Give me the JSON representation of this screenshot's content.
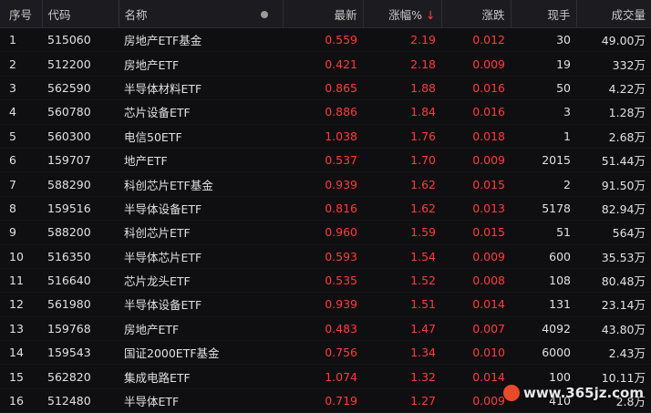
{
  "header": {
    "seq": "序号",
    "code": "代码",
    "name": "名称",
    "latest": "最新",
    "pct": "涨幅%",
    "change": "涨跌",
    "volume": "现手",
    "amount": "成交量"
  },
  "rows": [
    {
      "seq": "1",
      "code": "515060",
      "name": "房地产ETF基金",
      "latest": "0.559",
      "pct": "2.19",
      "change": "0.012",
      "volume": "30",
      "amount": "49.00万"
    },
    {
      "seq": "2",
      "code": "512200",
      "name": "房地产ETF",
      "latest": "0.421",
      "pct": "2.18",
      "change": "0.009",
      "volume": "19",
      "amount": "332万"
    },
    {
      "seq": "3",
      "code": "562590",
      "name": "半导体材料ETF",
      "latest": "0.865",
      "pct": "1.88",
      "change": "0.016",
      "volume": "50",
      "amount": "4.22万"
    },
    {
      "seq": "4",
      "code": "560780",
      "name": "芯片设备ETF",
      "latest": "0.886",
      "pct": "1.84",
      "change": "0.016",
      "volume": "3",
      "amount": "1.28万"
    },
    {
      "seq": "5",
      "code": "560300",
      "name": "电信50ETF",
      "latest": "1.038",
      "pct": "1.76",
      "change": "0.018",
      "volume": "1",
      "amount": "2.68万"
    },
    {
      "seq": "6",
      "code": "159707",
      "name": "地产ETF",
      "latest": "0.537",
      "pct": "1.70",
      "change": "0.009",
      "volume": "2015",
      "amount": "51.44万"
    },
    {
      "seq": "7",
      "code": "588290",
      "name": "科创芯片ETF基金",
      "latest": "0.939",
      "pct": "1.62",
      "change": "0.015",
      "volume": "2",
      "amount": "91.50万"
    },
    {
      "seq": "8",
      "code": "159516",
      "name": "半导体设备ETF",
      "latest": "0.816",
      "pct": "1.62",
      "change": "0.013",
      "volume": "5178",
      "amount": "82.94万"
    },
    {
      "seq": "9",
      "code": "588200",
      "name": "科创芯片ETF",
      "latest": "0.960",
      "pct": "1.59",
      "change": "0.015",
      "volume": "51",
      "amount": "564万"
    },
    {
      "seq": "10",
      "code": "516350",
      "name": "半导体芯片ETF",
      "latest": "0.593",
      "pct": "1.54",
      "change": "0.009",
      "volume": "600",
      "amount": "35.53万"
    },
    {
      "seq": "11",
      "code": "516640",
      "name": "芯片龙头ETF",
      "latest": "0.535",
      "pct": "1.52",
      "change": "0.008",
      "volume": "108",
      "amount": "80.48万"
    },
    {
      "seq": "12",
      "code": "561980",
      "name": "半导体设备ETF",
      "latest": "0.939",
      "pct": "1.51",
      "change": "0.014",
      "volume": "131",
      "amount": "23.14万"
    },
    {
      "seq": "13",
      "code": "159768",
      "name": "房地产ETF",
      "latest": "0.483",
      "pct": "1.47",
      "change": "0.007",
      "volume": "4092",
      "amount": "43.80万"
    },
    {
      "seq": "14",
      "code": "159543",
      "name": "国证2000ETF基金",
      "latest": "0.756",
      "pct": "1.34",
      "change": "0.010",
      "volume": "6000",
      "amount": "2.43万"
    },
    {
      "seq": "15",
      "code": "562820",
      "name": "集成电路ETF",
      "latest": "1.074",
      "pct": "1.32",
      "change": "0.014",
      "volume": "100",
      "amount": "10.11万"
    },
    {
      "seq": "16",
      "code": "512480",
      "name": "半导体ETF",
      "latest": "0.719",
      "pct": "1.27",
      "change": "0.009",
      "volume": "410",
      "amount": "2.8万"
    }
  ],
  "watermark": "www.365jz.com",
  "colors": {
    "up": "#ff3b3b",
    "background": "#0f0f12",
    "header_bg": "#1c1c20"
  },
  "icons": {
    "sort": "arrow-down-icon",
    "column_toggle": "dot-icon",
    "watermark_logo": "logo-icon"
  }
}
